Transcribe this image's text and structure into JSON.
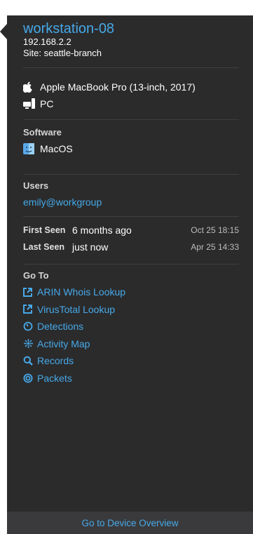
{
  "device": {
    "hostname": "workstation-08",
    "ip": "192.168.2.2",
    "site": "Site: seattle-branch",
    "model": "Apple MacBook Pro (13-inch, 2017)",
    "type": "PC"
  },
  "software": {
    "title": "Software",
    "os": "MacOS"
  },
  "users": {
    "title": "Users",
    "user": "emily@workgroup"
  },
  "seen": {
    "first_label": "First Seen",
    "first_value": "6 months ago",
    "first_time": "Oct 25 18:15",
    "last_label": "Last Seen",
    "last_value": "just now",
    "last_time": "Apr 25 14:33"
  },
  "goto": {
    "title": "Go To",
    "items": [
      {
        "label": "ARIN Whois Lookup",
        "icon": "external-link-icon"
      },
      {
        "label": "VirusTotal Lookup",
        "icon": "external-link-icon"
      },
      {
        "label": "Detections",
        "icon": "gauge-icon"
      },
      {
        "label": "Activity Map",
        "icon": "activity-map-icon"
      },
      {
        "label": "Records",
        "icon": "search-icon"
      },
      {
        "label": "Packets",
        "icon": "target-icon"
      }
    ]
  },
  "footer": {
    "label": "Go to Device Overview"
  },
  "colors": {
    "panel_bg": "#2b2b2c",
    "footer_bg": "#3a3a3c",
    "link": "#46a9e8",
    "divider": "#3f3f41"
  }
}
